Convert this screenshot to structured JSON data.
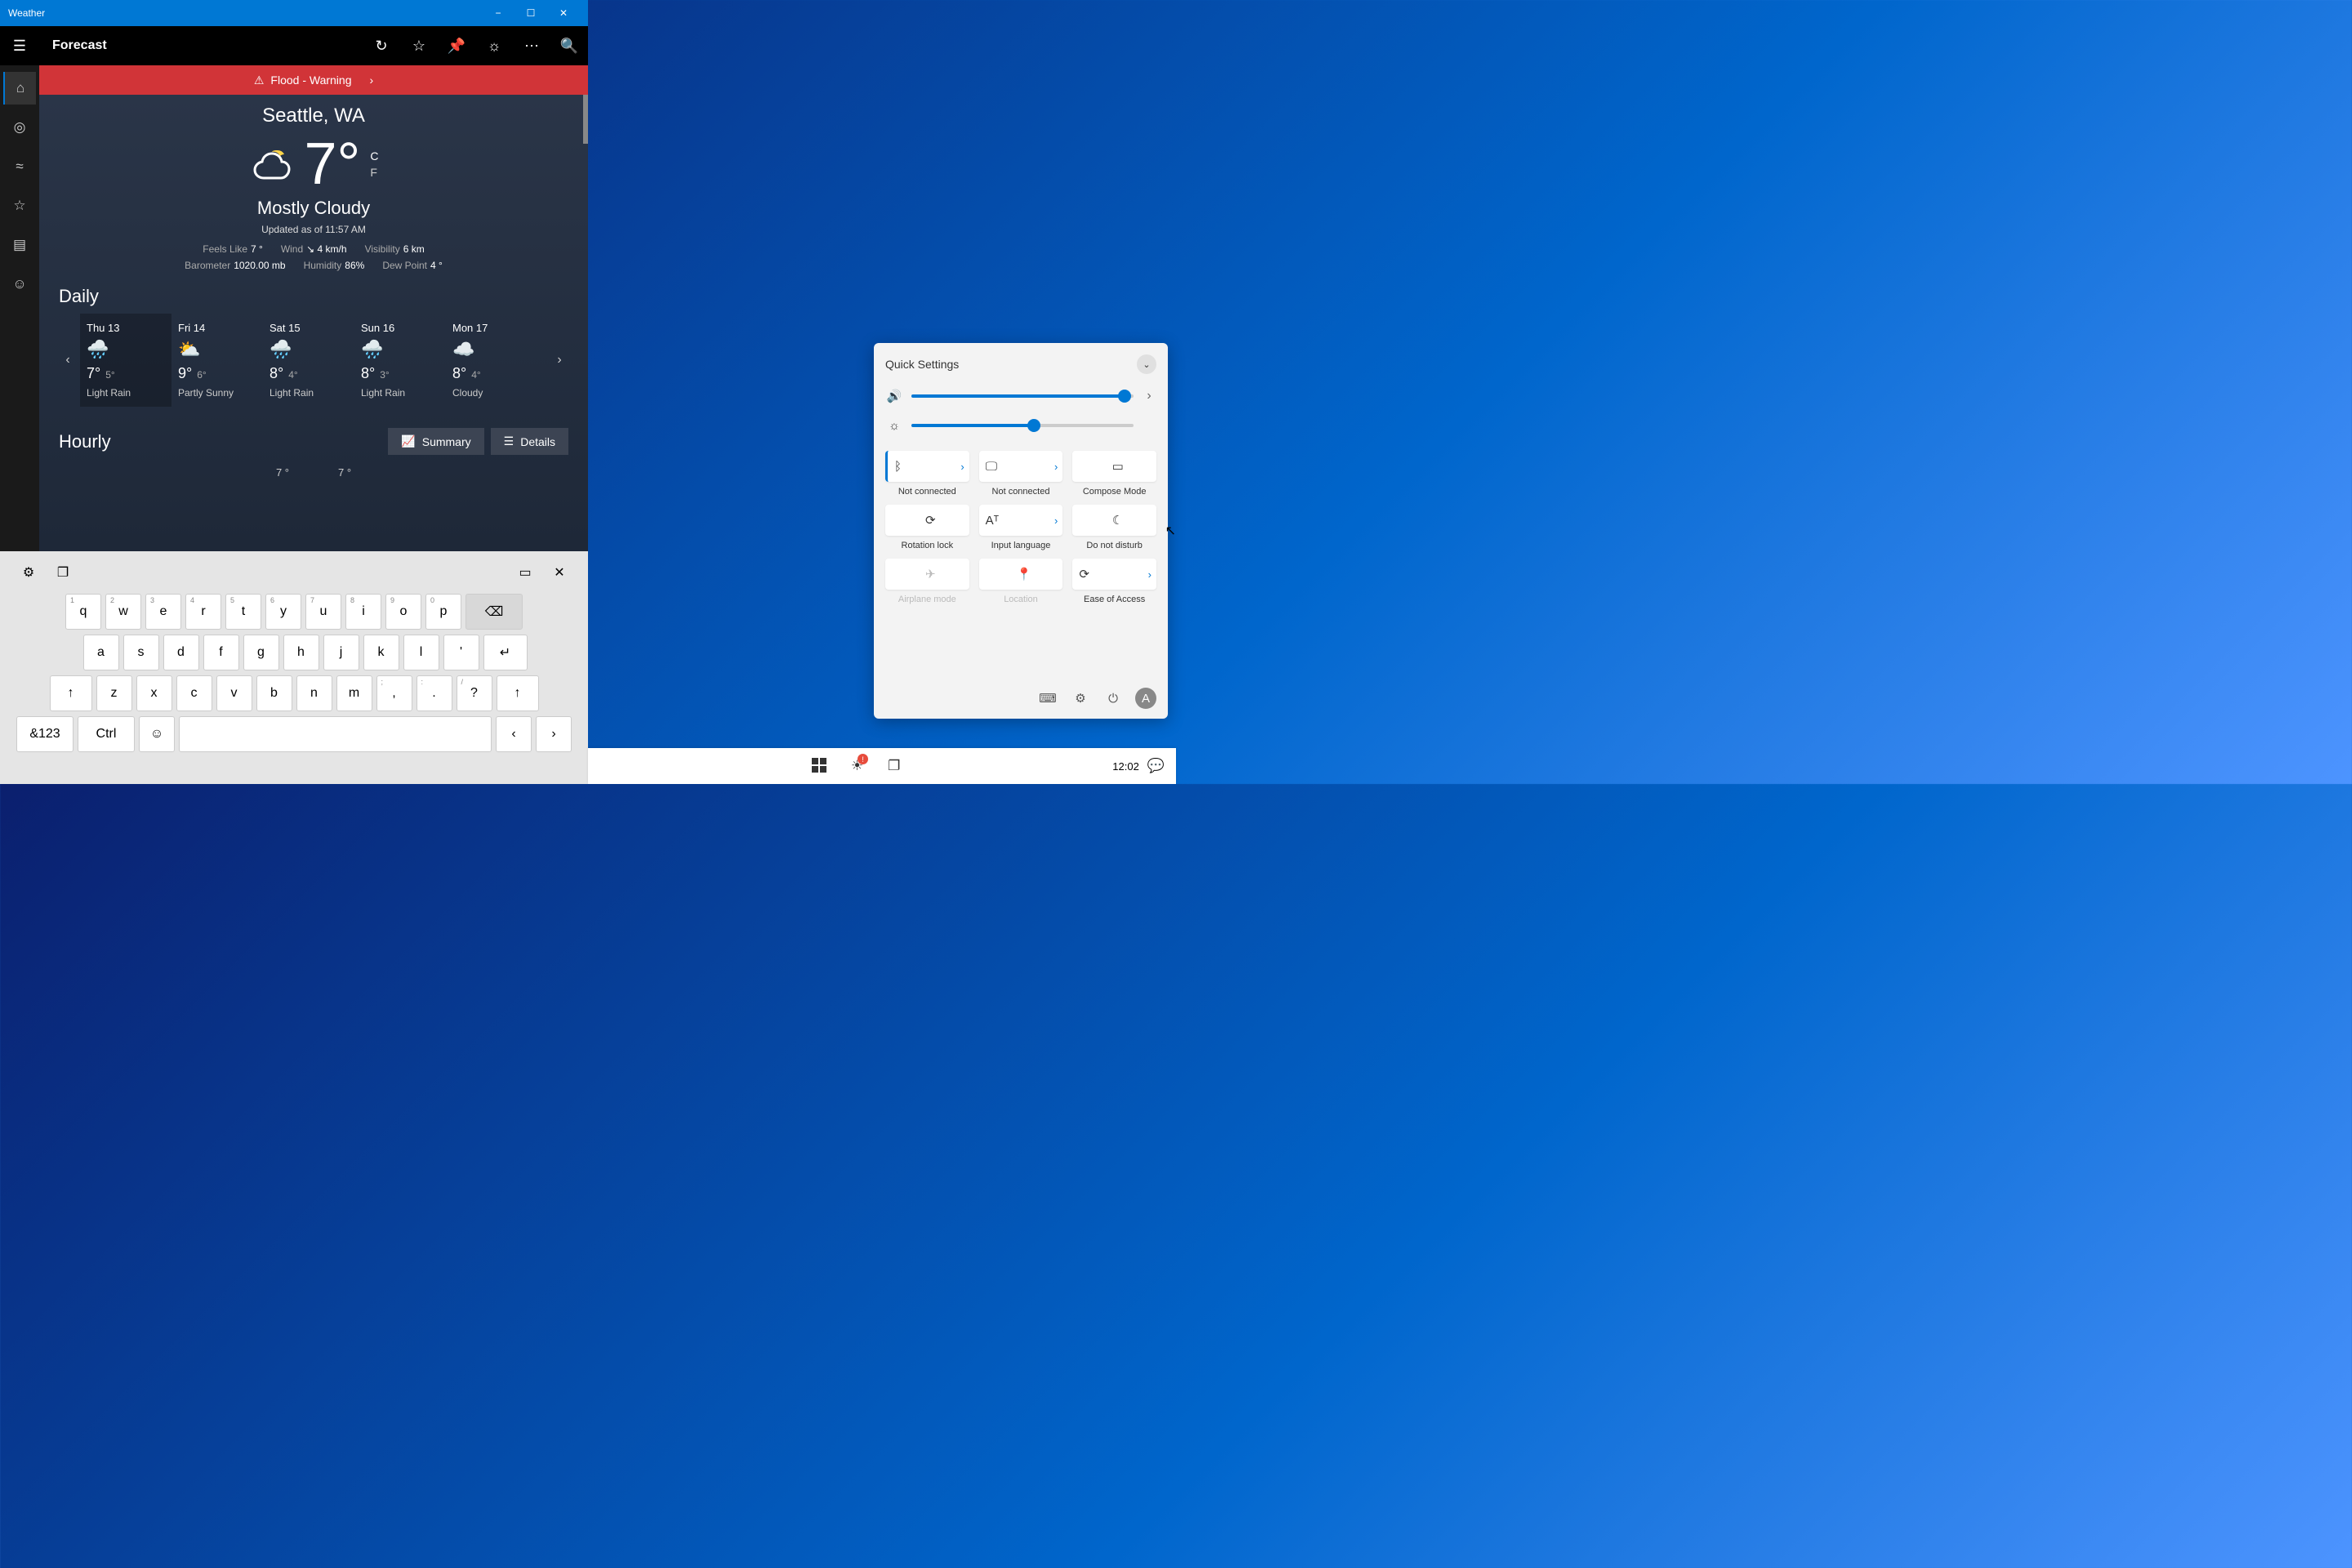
{
  "window": {
    "title": "Weather"
  },
  "app": {
    "page_title": "Forecast",
    "alert": "Flood - Warning",
    "location": "Seattle, WA",
    "temp": "7°",
    "unit_c": "C",
    "unit_f": "F",
    "condition": "Mostly Cloudy",
    "updated": "Updated as of 11:57 AM",
    "stats": {
      "feels_label": "Feels Like",
      "feels": "7 °",
      "wind_label": "Wind",
      "wind": "↘ 4 km/h",
      "vis_label": "Visibility",
      "vis": "6 km",
      "baro_label": "Barometer",
      "baro": "1020.00 mb",
      "hum_label": "Humidity",
      "hum": "86%",
      "dew_label": "Dew Point",
      "dew": "4 °"
    },
    "daily_header": "Daily",
    "daily": [
      {
        "name": "Thu 13",
        "icon": "🌧️",
        "hi": "7°",
        "lo": "5°",
        "cond": "Light Rain"
      },
      {
        "name": "Fri 14",
        "icon": "⛅",
        "hi": "9°",
        "lo": "6°",
        "cond": "Partly Sunny"
      },
      {
        "name": "Sat 15",
        "icon": "🌧️",
        "hi": "8°",
        "lo": "4°",
        "cond": "Light Rain"
      },
      {
        "name": "Sun 16",
        "icon": "🌧️",
        "hi": "8°",
        "lo": "3°",
        "cond": "Light Rain"
      },
      {
        "name": "Mon 17",
        "icon": "☁️",
        "hi": "8°",
        "lo": "4°",
        "cond": "Cloudy"
      }
    ],
    "hourly_header": "Hourly",
    "summary_btn": "Summary",
    "details_btn": "Details",
    "hourly": [
      "7 °",
      "7 °"
    ]
  },
  "qs": {
    "title": "Quick Settings",
    "volume": 96,
    "brightness": 55,
    "tiles": [
      {
        "icon": "bt",
        "label": "Not connected",
        "active": true,
        "chev": true
      },
      {
        "icon": "display",
        "label": "Not connected",
        "chev": true
      },
      {
        "icon": "compose",
        "label": "Compose Mode"
      },
      {
        "icon": "rotation",
        "label": "Rotation lock"
      },
      {
        "icon": "lang",
        "label": "Input language",
        "chev": true
      },
      {
        "icon": "dnd",
        "label": "Do not disturb"
      },
      {
        "icon": "airplane",
        "label": "Airplane mode",
        "disabled": true
      },
      {
        "icon": "location",
        "label": "Location",
        "disabled": true
      },
      {
        "icon": "ease",
        "label": "Ease of Access",
        "chev": true
      }
    ],
    "avatar": "A"
  },
  "keyboard": {
    "row1": [
      [
        "1",
        "q"
      ],
      [
        "2",
        "w"
      ],
      [
        "3",
        "e"
      ],
      [
        "4",
        "r"
      ],
      [
        "5",
        "t"
      ],
      [
        "6",
        "y"
      ],
      [
        "7",
        "u"
      ],
      [
        "8",
        "i"
      ],
      [
        "9",
        "o"
      ],
      [
        "0",
        "p"
      ]
    ],
    "row2": [
      "a",
      "s",
      "d",
      "f",
      "g",
      "h",
      "j",
      "k",
      "l",
      "'"
    ],
    "row3": [
      "z",
      "x",
      "c",
      "v",
      "b",
      "n",
      "m",
      [
        " :",
        " ,"
      ],
      [
        " ;",
        " ."
      ],
      [
        " ?",
        " /",
        "?"
      ]
    ],
    "sym": "&123",
    "ctrl": "Ctrl"
  },
  "taskbar": {
    "clock": "12:02"
  }
}
